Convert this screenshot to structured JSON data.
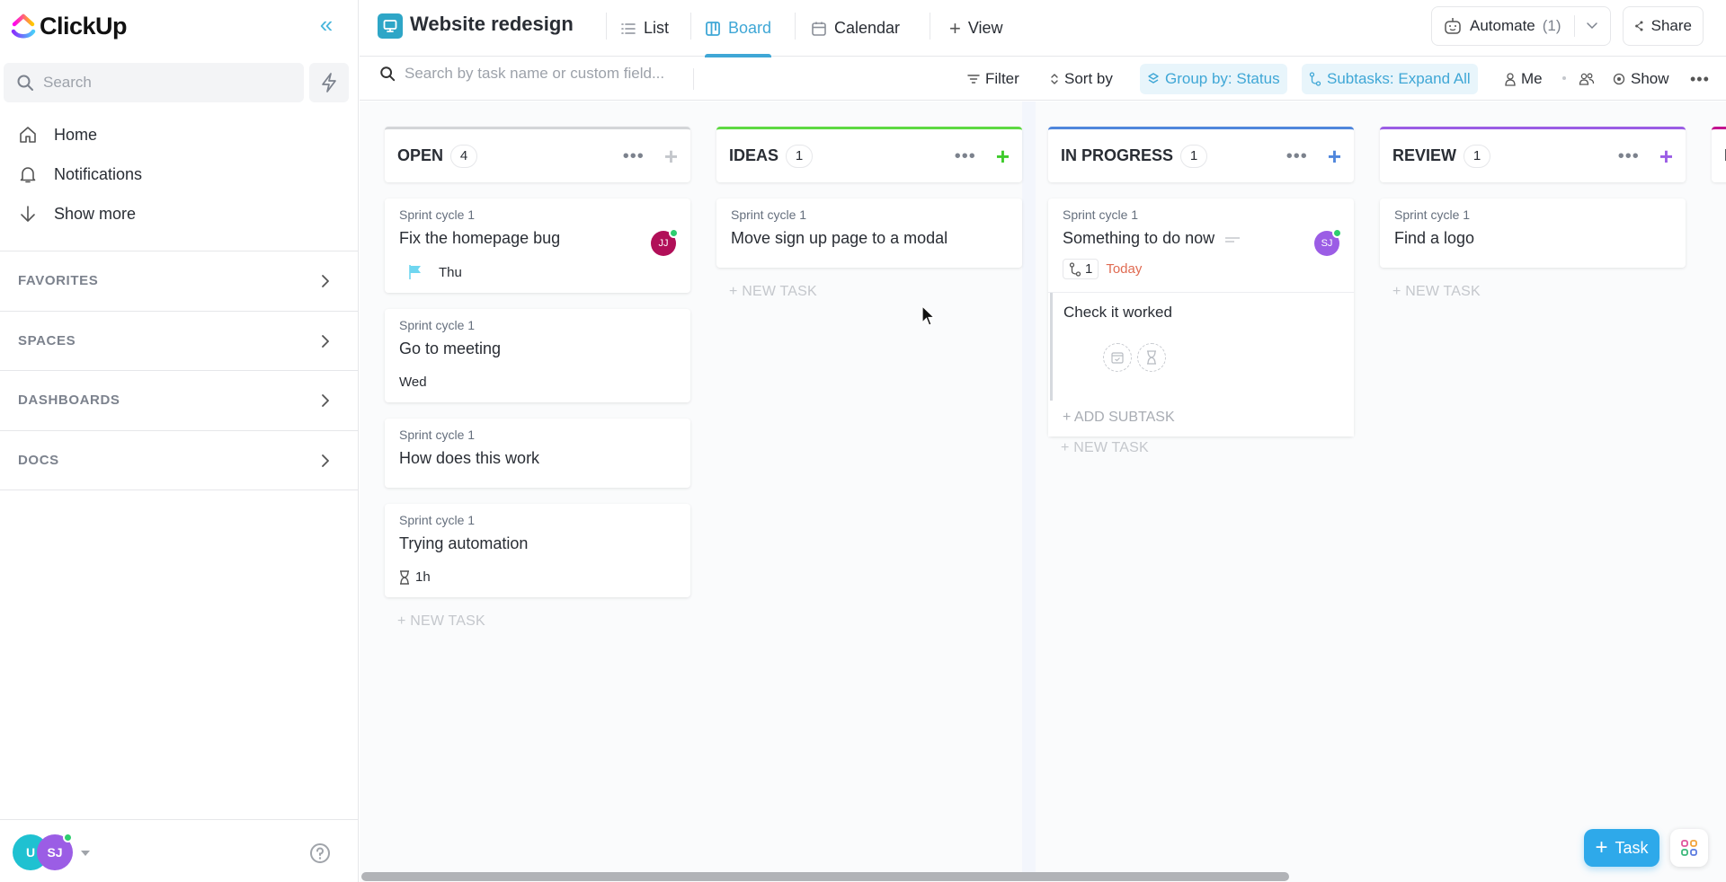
{
  "app": {
    "name": "ClickUp"
  },
  "sidebar": {
    "search_placeholder": "Search",
    "nav": [
      {
        "label": "Home",
        "icon": "home-icon"
      },
      {
        "label": "Notifications",
        "icon": "bell-icon"
      },
      {
        "label": "Show more",
        "icon": "arrow-down-icon"
      }
    ],
    "sections": [
      {
        "label": "FAVORITES"
      },
      {
        "label": "SPACES"
      },
      {
        "label": "DASHBOARDS"
      },
      {
        "label": "DOCS"
      }
    ],
    "footer": {
      "avatars": [
        {
          "initials": "U",
          "color": "#1fc1d1"
        },
        {
          "initials": "SJ",
          "color": "#9b5de5"
        }
      ]
    }
  },
  "header": {
    "project_title": "Website redesign",
    "tabs": [
      {
        "label": "List",
        "icon": "list-icon",
        "active": false
      },
      {
        "label": "Board",
        "icon": "board-icon",
        "active": true
      },
      {
        "label": "Calendar",
        "icon": "calendar-icon",
        "active": false
      }
    ],
    "add_view_label": "View",
    "automate_label": "Automate",
    "automate_count": "(1)",
    "share_label": "Share"
  },
  "toolbar": {
    "search_placeholder": "Search by task name or custom field...",
    "filter_label": "Filter",
    "sort_label": "Sort by",
    "group_label": "Group by: Status",
    "subtasks_label": "Subtasks: Expand All",
    "me_label": "Me",
    "show_label": "Show"
  },
  "colors": {
    "accent": "#3fa7d6",
    "open": "#d3d5d8",
    "ideas": "#5ed942",
    "in_progress": "#4f86dc",
    "review": "#9b5de5",
    "next": "#c3128f",
    "today": "#e06b52"
  },
  "board": {
    "columns": [
      {
        "title": "OPEN",
        "count": "4",
        "new_task": "+ NEW TASK",
        "cards": [
          {
            "list": "Sprint cycle 1",
            "name": "Fix the homepage bug",
            "assignee": "JJ",
            "assignee_color": "#b10f58",
            "due": "Thu",
            "priority": "flag"
          },
          {
            "list": "Sprint cycle 1",
            "name": "Go to meeting",
            "due": "Wed"
          },
          {
            "list": "Sprint cycle 1",
            "name": "How does this work"
          },
          {
            "list": "Sprint cycle 1",
            "name": "Trying automation",
            "estimate": "1h"
          }
        ]
      },
      {
        "title": "IDEAS",
        "count": "1",
        "new_task": "+ NEW TASK",
        "cards": [
          {
            "list": "Sprint cycle 1",
            "name": "Move sign up page to a modal"
          }
        ]
      },
      {
        "title": "IN PROGRESS",
        "count": "1",
        "new_task": "+ NEW TASK",
        "cards": [
          {
            "list": "Sprint cycle 1",
            "name": "Something to do now",
            "assignee": "SJ",
            "assignee_color": "#9b5de5",
            "subtask_count": "1",
            "due": "Today",
            "subtasks": [
              {
                "name": "Check it worked"
              }
            ],
            "add_subtask": "+ ADD SUBTASK"
          }
        ]
      },
      {
        "title": "REVIEW",
        "count": "1",
        "new_task": "+ NEW TASK",
        "cards": [
          {
            "list": "Sprint cycle 1",
            "name": "Find a logo"
          }
        ]
      },
      {
        "title": "D",
        "partial": true
      }
    ]
  },
  "fab": {
    "label": "Task"
  }
}
